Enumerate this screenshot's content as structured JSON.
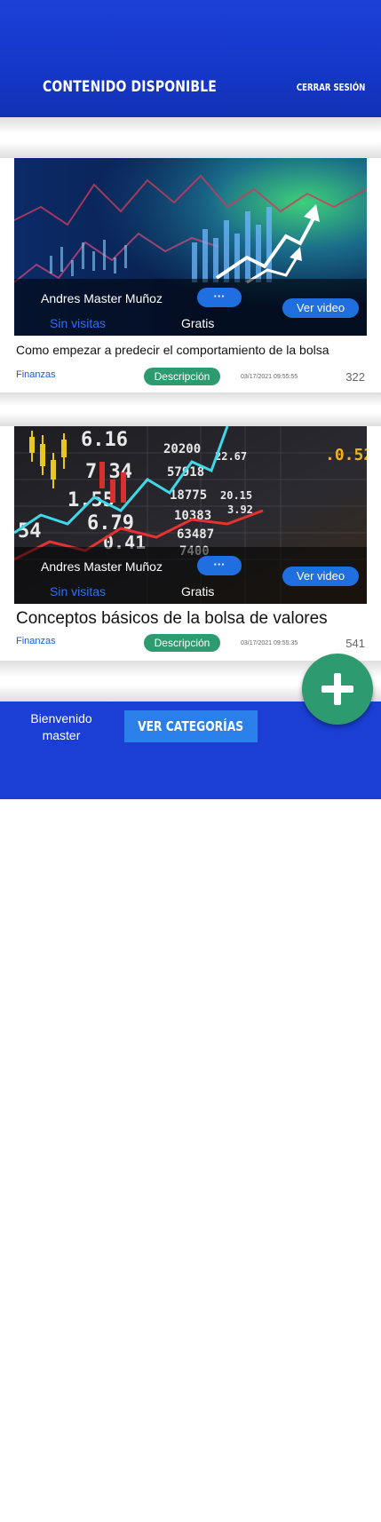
{
  "header": {
    "title": "CONTENIDO DISPONIBLE",
    "logout_label": "CERRAR SESIÓN"
  },
  "cards": [
    {
      "author": "Andres Master Muñoz",
      "more_label": "···",
      "visits": "Sin visitas",
      "price": "Gratis",
      "video_label": "Ver video",
      "title": "Como empezar a predecir el comportamiento de la bolsa",
      "category": "Finanzas",
      "description_label": "Descripción",
      "date": "03/17/2021 09:55:55",
      "views": "322"
    },
    {
      "author": "Andres Master Muñoz",
      "more_label": "···",
      "visits": "Sin visitas",
      "price": "Gratis",
      "video_label": "Ver video",
      "title": "Conceptos básicos de la bolsa de valores",
      "category": "Finanzas",
      "description_label": "Descripción",
      "date": "03/17/2021 09:55:35",
      "views": "541"
    }
  ],
  "thumb2_numbers": [
    "6.16",
    "20200",
    "7.34",
    "57918",
    "1.55",
    "18775",
    "20.15",
    "6.79",
    "10383",
    "3.92",
    "63487",
    "0.41",
    "7400",
    "22.67",
    ".0.52",
    "54"
  ],
  "fab": {
    "icon": "plus-icon"
  },
  "footer": {
    "welcome": "Bienvenido master",
    "categories_label": "VER CATEGORÍAS"
  },
  "colors": {
    "primary": "#1b3fd4",
    "accent_green": "#2e9a6f",
    "button_blue": "#1f6fe0"
  }
}
